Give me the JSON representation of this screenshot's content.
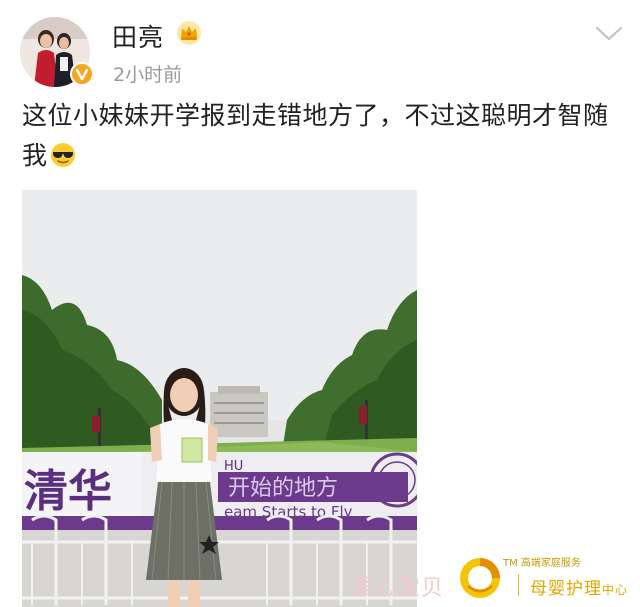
{
  "post": {
    "username": "田亮",
    "time": "2小时前",
    "text": "这位小妹妹开学报到走错地方了，不过这聪明才智随我"
  },
  "photo": {
    "sign_left": "清华",
    "sign_right_small": "HU",
    "sign_middle": "开始的地方",
    "sign_english": "eam Starts to Fly"
  },
  "watermark": {
    "left_text": "爱心宝贝",
    "tm_line": "TM 高端家庭服务",
    "right_text": "母婴护理",
    "right_small": "中心"
  },
  "colors": {
    "badge": "#f5a623",
    "time_gray": "#9a9a9a",
    "sign_purple": "#6b3a8c",
    "watermark_gold": "#e0a800"
  },
  "icons": {
    "verified": "v-badge-icon",
    "crown": "crown-icon",
    "more": "chevron-down-icon",
    "emoji": "sunglasses-emoji-icon"
  }
}
